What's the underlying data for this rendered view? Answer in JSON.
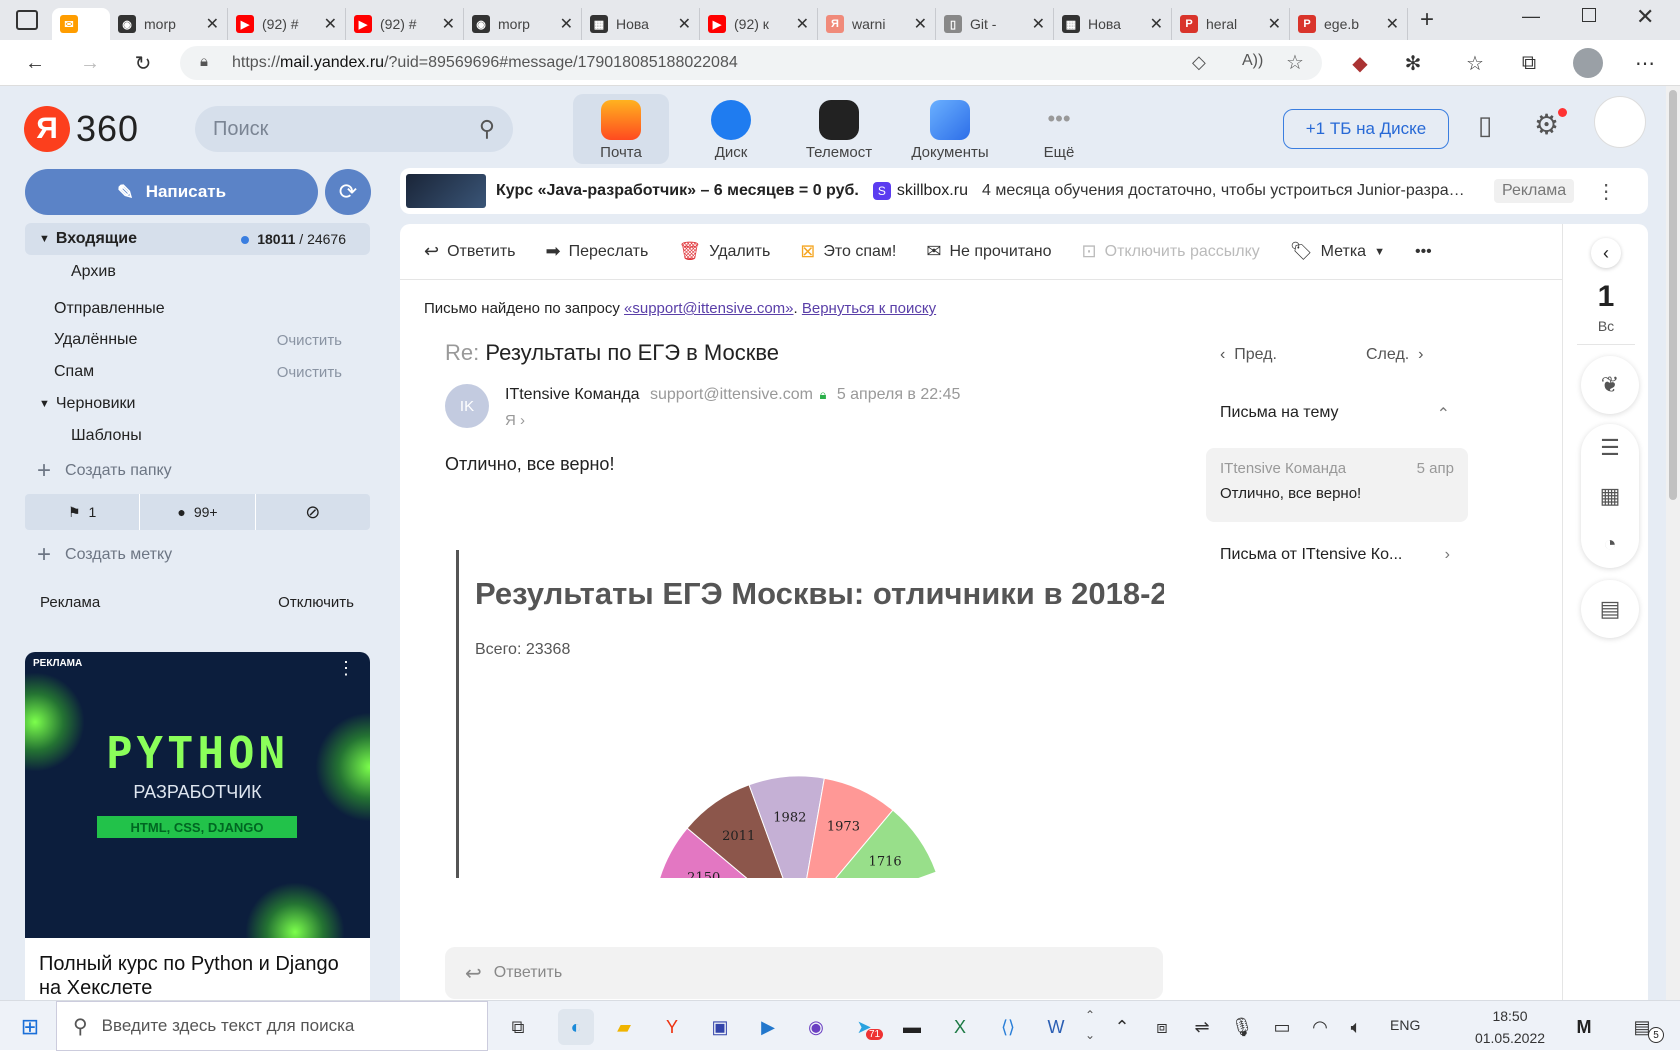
{
  "browser": {
    "tabs": [
      {
        "title": "",
        "color": "#ff9d00",
        "icon": "mail-envelope-icon",
        "glyph": "✉",
        "active": true
      },
      {
        "title": "morp",
        "color": "#333333",
        "icon": "github-icon",
        "glyph": "◉"
      },
      {
        "title": "(92) #",
        "color": "#ff0000",
        "icon": "youtube-icon",
        "glyph": "▶"
      },
      {
        "title": "(92) #",
        "color": "#ff0000",
        "icon": "youtube-icon",
        "glyph": "▶"
      },
      {
        "title": "morp",
        "color": "#333333",
        "icon": "github-icon",
        "glyph": "◉"
      },
      {
        "title": "Нова",
        "color": "#333333",
        "icon": "newtab-icon",
        "glyph": "▦"
      },
      {
        "title": "(92) к",
        "color": "#ff0000",
        "icon": "youtube-icon",
        "glyph": "▶"
      },
      {
        "title": "warni",
        "color": "#f08a7a",
        "icon": "yandex-icon",
        "glyph": "Я"
      },
      {
        "title": "Git - ",
        "color": "#888888",
        "icon": "document-icon",
        "glyph": "▯"
      },
      {
        "title": "Нова",
        "color": "#333333",
        "icon": "newtab-icon",
        "glyph": "▦"
      },
      {
        "title": "heral",
        "color": "#d9342b",
        "icon": "pdf-icon",
        "glyph": "P"
      },
      {
        "title": "ege.b",
        "color": "#d9342b",
        "icon": "pdf-icon",
        "glyph": "P"
      }
    ],
    "url_prefix": "https://",
    "url_host": "mail.yandex.ru",
    "url_rest": "/?uid=89569696#message/179018085188022084"
  },
  "header": {
    "logo_ya": "Я",
    "logo_360": "360",
    "search_placeholder": "Поиск",
    "services": [
      {
        "label": "Почта",
        "color": "#ff6a1f",
        "active": true
      },
      {
        "label": "Диск",
        "color": "#1f7cf0"
      },
      {
        "label": "Телемост",
        "color": "#222222"
      },
      {
        "label": "Документы",
        "color": "#3f8cf5"
      },
      {
        "label": "Ещё",
        "color": ""
      }
    ],
    "disk_promo": "+1 ТБ на Диске"
  },
  "sidebar": {
    "compose": "Написать",
    "inbox": "Входящие",
    "inbox_unread": "18011",
    "inbox_total": "24676",
    "archive": "Архив",
    "sent": "Отправленные",
    "deleted": "Удалённые",
    "spam": "Спам",
    "clear": "Очистить",
    "drafts": "Черновики",
    "templates": "Шаблоны",
    "create_folder": "Создать папку",
    "flag_count": "1",
    "unread_count": "99+",
    "create_label": "Создать метку",
    "ads_label": "Реклама",
    "ads_disable": "Отключить",
    "ad_badge": "РЕКЛАМА",
    "ad_title": "PYTHON",
    "ad_subtitle": "РАЗРАБОТЧИК",
    "ad_tags": "HTML, CSS, DJANGO",
    "ad_text": "Полный курс по Python и Django на Хекслете"
  },
  "banner": {
    "title": "Курс «Java-разработчик» – 6 месяцев = 0 руб.",
    "domain": "skillbox.ru",
    "text": "4 месяца обучения достаточно, чтобы устроиться Junior-разра…",
    "ad": "Реклама"
  },
  "toolbar": {
    "reply": "Ответить",
    "forward": "Переслать",
    "delete": "Удалить",
    "spam": "Это спам!",
    "unread": "Не прочитано",
    "unsubscribe": "Отключить рассылку",
    "label": "Метка"
  },
  "message": {
    "found_prefix": "Письмо найдено по запросу",
    "query": "«support@ittensive.com»",
    "back_to_search": "Вернуться к поиску",
    "subject_prefix": "Re:",
    "subject": "Результаты по ЕГЭ в Москве",
    "avatar": "IK",
    "sender_name": "ITtensive Команда",
    "sender_email": "support@ittensive.com",
    "date": "5 апреля в 22:45",
    "to": "Я",
    "body": "Отлично, все верно!",
    "quote_title": "Результаты ЕГЭ Москвы: отличники в 2018-2",
    "quote_total": "Всего: 23368",
    "reply_placeholder": "Ответить"
  },
  "thread": {
    "prev": "Пред.",
    "next": "След.",
    "on_topic": "Письма на тему",
    "item_sender": "ITtensive Команда",
    "item_date": "5 апр",
    "item_text": "Отлично, все верно!",
    "from_sender": "Письма от ITtensive Ко..."
  },
  "rail": {
    "day": "1",
    "weekday": "Вс"
  },
  "chart_data": {
    "type": "pie",
    "visible_slices": [
      {
        "label": "2150",
        "color": "#e377c2"
      },
      {
        "label": "2011",
        "color": "#8c564b"
      },
      {
        "label": "1982",
        "color": "#c5b0d5"
      },
      {
        "label": "1973",
        "color": "#ff9896"
      },
      {
        "label": "1716",
        "color": "#98df8a"
      }
    ]
  },
  "taskbar": {
    "search_placeholder": "Введите здесь текст для поиска",
    "lang": "ENG",
    "time": "18:50",
    "date": "01.05.2022",
    "telegram_badge": "71",
    "notif_count": "5"
  }
}
